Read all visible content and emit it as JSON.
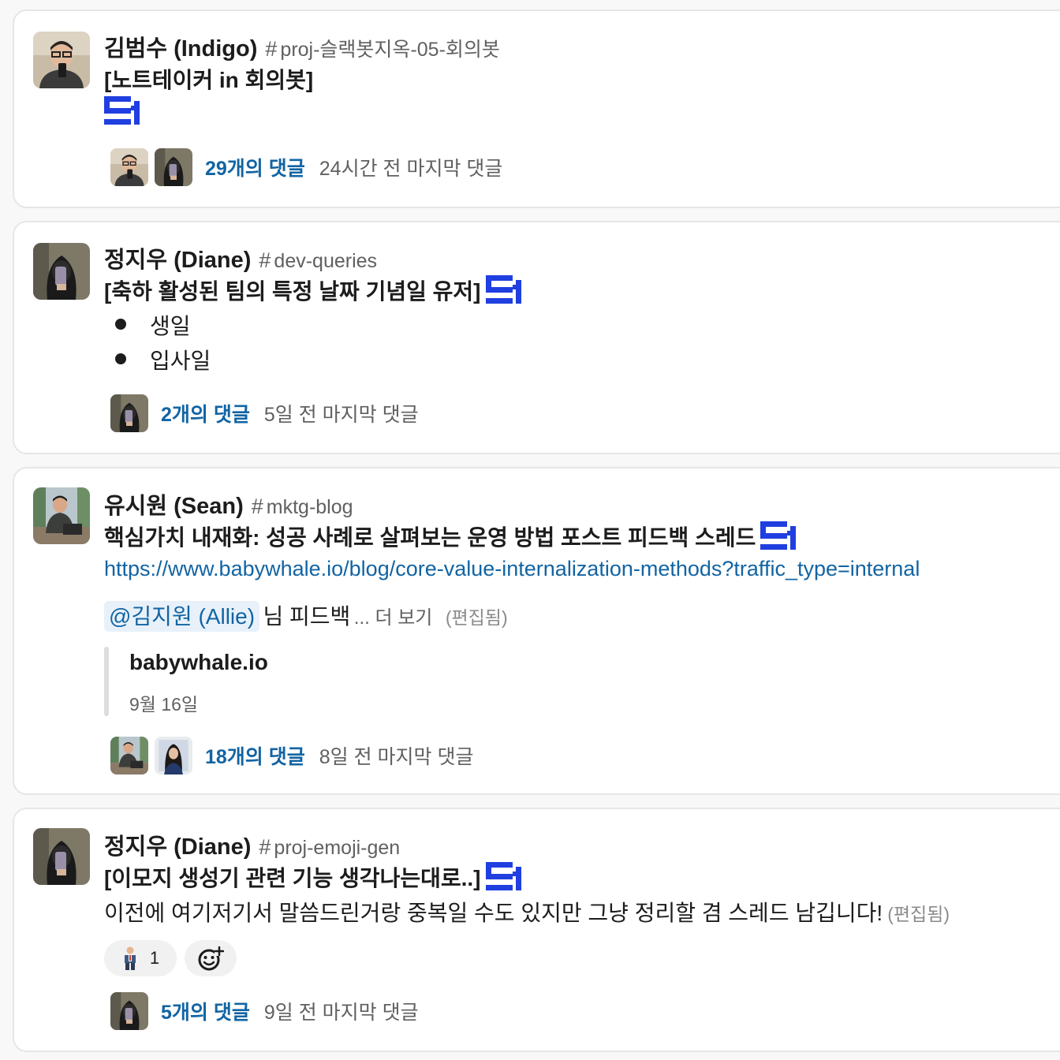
{
  "threads": [
    {
      "author": "김범수 (Indigo)",
      "hash": "#",
      "channel": "proj-슬랙봇지옥-05-회의봇",
      "title": "[노트테이커 in 회의봇]",
      "reply_count": "29개의 댓글",
      "last_reply": "24시간 전 마지막 댓글"
    },
    {
      "author": "정지우 (Diane)",
      "hash": "#",
      "channel": "dev-queries",
      "title": "[축하 활성된 팀의 특정 날짜 기념일 유저]",
      "bullets": [
        "생일",
        "입사일"
      ],
      "reply_count": "2개의 댓글",
      "last_reply": "5일 전 마지막 댓글"
    },
    {
      "author": "유시원 (Sean)",
      "hash": "#",
      "channel": "mktg-blog",
      "title": "핵심가치 내재화: 성공 사례로 살펴보는 운영 방법 포스트 피드백 스레드",
      "link": "https://www.babywhale.io/blog/core-value-internalization-methods?traffic_type=internal",
      "mention": "@김지원 (Allie)",
      "mention_suffix": "님 피드백",
      "more": "... 더 보기",
      "edited": "(편집됨)",
      "unfurl_title": "babywhale.io",
      "unfurl_date": "9월 16일",
      "reply_count": "18개의 댓글",
      "last_reply": "8일 전 마지막 댓글"
    },
    {
      "author": "정지우 (Diane)",
      "hash": "#",
      "channel": "proj-emoji-gen",
      "title": "[이모지 생성기 관련 기능 생각나는대로..]",
      "body": "이전에 여기저기서 말씀드린거랑 중복일 수도 있지만 그냥 정리할 겸 스레드 남깁니다!",
      "edited": "(편집됨)",
      "reaction_count": "1",
      "reply_count": "5개의 댓글",
      "last_reply": "9일 전 마지막 댓글"
    }
  ],
  "icons": {
    "logo": "brand-logo-icon",
    "add_reaction": "add-reaction-icon",
    "reaction_emoji": "person-standing-emoji-icon"
  },
  "colors": {
    "link": "#1264a3",
    "logo_blue": "#1f3fe0",
    "card_border": "#e6e6e6"
  }
}
